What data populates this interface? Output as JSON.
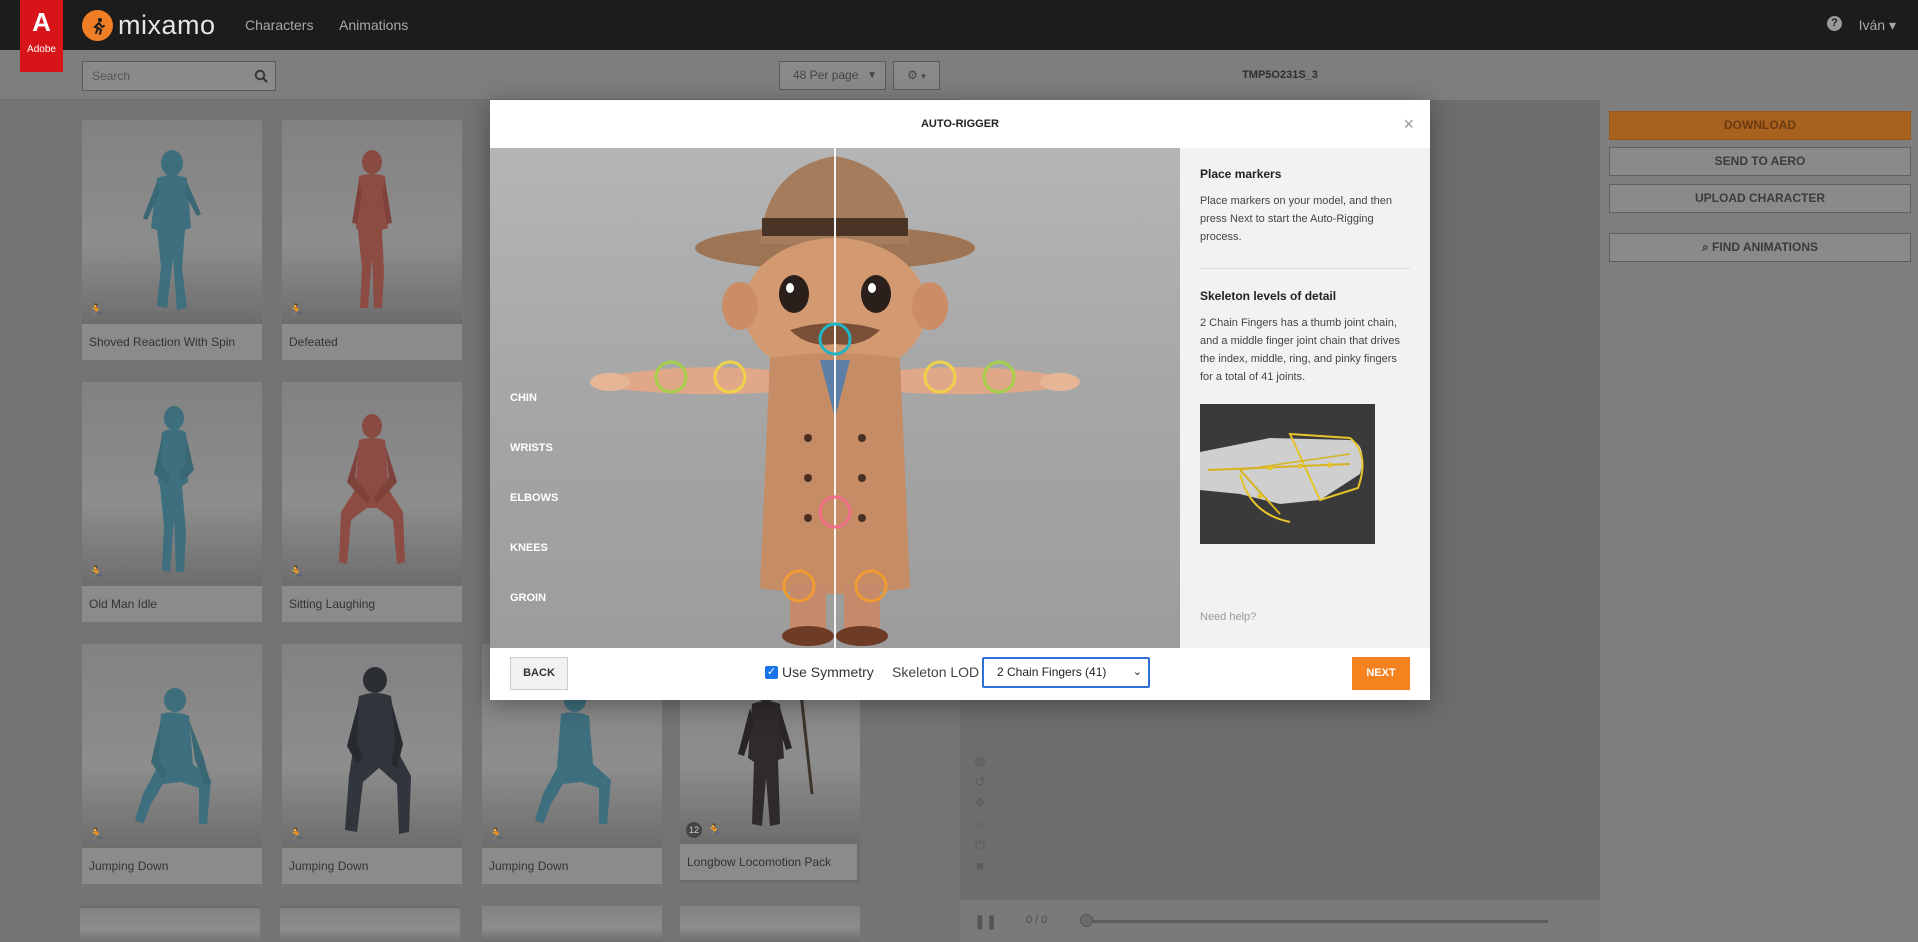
{
  "app": {
    "badge": "Adobe",
    "name": "mixamo"
  },
  "nav": {
    "characters": "Characters",
    "animations": "Animations"
  },
  "user": {
    "help_glyph": "?",
    "name": "Iván"
  },
  "library": {
    "search_placeholder": "Search",
    "per_page": "48 Per page",
    "cards": [
      {
        "title": "Shoved Reaction With Spin"
      },
      {
        "title": "Defeated"
      },
      {
        "title": "Old Man Idle"
      },
      {
        "title": "Sitting Laughing"
      },
      {
        "title": "Jumping Down"
      },
      {
        "title": "Jumping Down"
      },
      {
        "title": "Jumping Down"
      },
      {
        "title": "Longbow Locomotion Pack",
        "count": "12"
      }
    ]
  },
  "viewer": {
    "title": "TMP5O231S_3",
    "frames": "0 / 0"
  },
  "sidepanel": {
    "download": "DOWNLOAD",
    "send_to_aero": "SEND TO AERO",
    "upload_character": "UPLOAD CHARACTER",
    "find_animations": "FIND ANIMATIONS"
  },
  "modal": {
    "title": "AUTO-RIGGER",
    "close": "×",
    "marker_labels": [
      "CHIN",
      "WRISTS",
      "ELBOWS",
      "KNEES",
      "GROIN"
    ],
    "info": {
      "heading1": "Place markers",
      "body1": "Place markers on your model, and then press Next to start the Auto-Rigging process.",
      "heading2": "Skeleton levels of detail",
      "body2": "2 Chain Fingers has a thumb joint chain, and a middle finger joint chain that drives the index, middle, ring, and pinky fingers for a total of 41 joints.",
      "need_help": "Need help?"
    },
    "footer": {
      "back": "BACK",
      "use_symmetry": "Use Symmetry",
      "skeleton_lod_label": "Skeleton LOD",
      "skeleton_lod_value": "2 Chain Fingers (41)",
      "next": "NEXT"
    }
  },
  "colors": {
    "accent": "#f5821f",
    "chin_marker": "#23b5c5",
    "wrist_marker": "#a6d04a",
    "elbow_marker": "#f0d24a",
    "knee_marker": "#f09a33",
    "groin_marker": "#ee6f86"
  }
}
